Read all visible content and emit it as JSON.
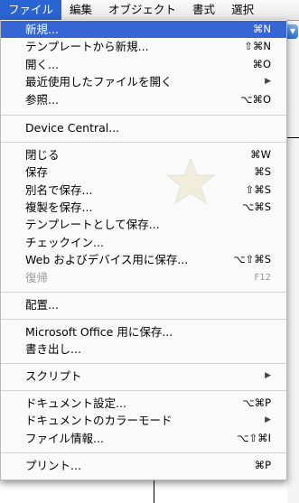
{
  "menubar": {
    "items": [
      "ファイル",
      "編集",
      "オブジェクト",
      "書式",
      "選択"
    ]
  },
  "menu": {
    "items": [
      {
        "label": "新規...",
        "shortcut": "⌘N"
      },
      {
        "label": "テンプレートから新規...",
        "shortcut": "⇧⌘N"
      },
      {
        "label": "開く...",
        "shortcut": "⌘O"
      },
      {
        "label": "最近使用したファイルを開く",
        "arrow": "▶"
      },
      {
        "label": "参照...",
        "shortcut": "⌥⌘O"
      },
      {
        "label": "Device Central..."
      },
      {
        "label": "閉じる",
        "shortcut": "⌘W"
      },
      {
        "label": "保存",
        "shortcut": "⌘S"
      },
      {
        "label": "別名で保存...",
        "shortcut": "⇧⌘S"
      },
      {
        "label": "複製を保存...",
        "shortcut": "⌥⌘S"
      },
      {
        "label": "テンプレートとして保存..."
      },
      {
        "label": "チェックイン..."
      },
      {
        "label": "Web およびデバイス用に保存...",
        "shortcut": "⌥⇧⌘S"
      },
      {
        "label": "復帰",
        "shortcut": "F12"
      },
      {
        "label": "配置..."
      },
      {
        "label": "Microsoft Office 用に保存..."
      },
      {
        "label": "書き出し..."
      },
      {
        "label": "スクリプト",
        "arrow": "▶"
      },
      {
        "label": "ドキュメント設定...",
        "shortcut": "⌥⌘P"
      },
      {
        "label": "ドキュメントのカラーモード",
        "arrow": "▶"
      },
      {
        "label": "ファイル情報...",
        "shortcut": "⌥⇧⌘I"
      },
      {
        "label": "プリント...",
        "shortcut": "⌘P"
      }
    ]
  },
  "colors": {
    "highlight": "#3666d4",
    "disabled": "#9a9a9a"
  }
}
